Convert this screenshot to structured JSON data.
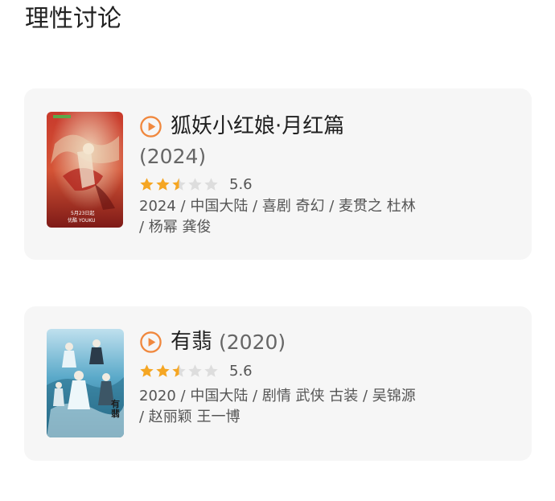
{
  "header": {
    "title": "理性讨论"
  },
  "colors": {
    "accent": "#f0883e",
    "star_filled": "#f5a623",
    "star_empty": "#dddddd",
    "card_bg": "#f6f6f6"
  },
  "movies": [
    {
      "title": "狐妖小红娘·月红篇",
      "year": "(2024)",
      "rating": {
        "stars": 2.5,
        "max": 5,
        "score": "5.6"
      },
      "meta": "2024 / 中国大陆 / 喜剧 奇幻 / 麦贯之 杜林 / 杨幂 龚俊",
      "poster": {
        "caption_date": "5月23日起",
        "caption_sub": "优酷 YOUKU"
      }
    },
    {
      "title": "有翡",
      "year": "(2020)",
      "rating": {
        "stars": 2.5,
        "max": 5,
        "score": "5.6"
      },
      "meta": "2020 / 中国大陆 / 剧情 武侠 古装 / 吴锦源 / 赵丽颖 王一博",
      "poster": {
        "caption_title": "有翡"
      }
    }
  ]
}
